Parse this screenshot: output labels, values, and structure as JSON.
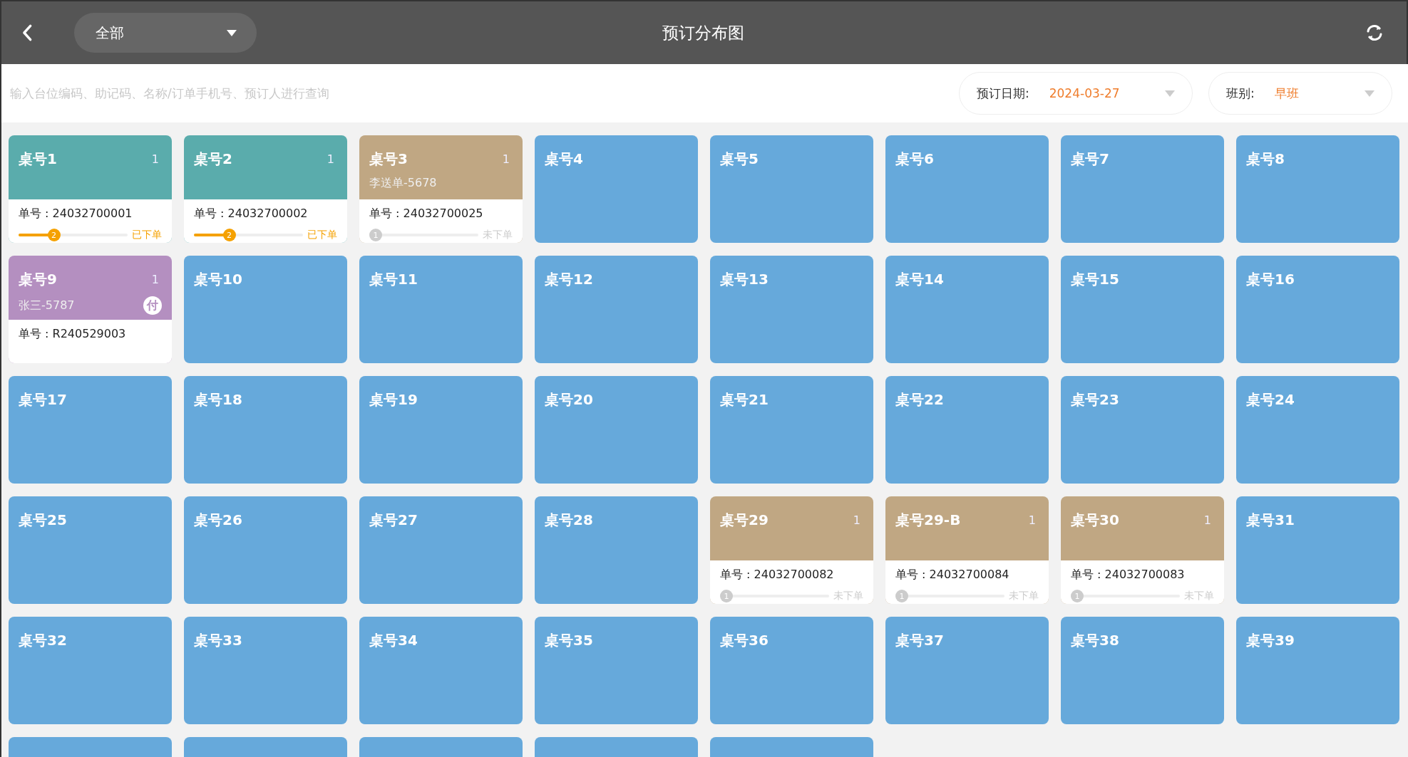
{
  "top_bar": {
    "title": "预订分布图",
    "area_filter": {
      "value": "全部"
    }
  },
  "search": {
    "placeholder": "输入台位编码、助记码、名称/订单手机号、预订人进行查询"
  },
  "filters": [
    {
      "label": "预订日期:",
      "value": "2024-03-27"
    },
    {
      "label": "班别:",
      "value": "早班"
    }
  ],
  "tables": [
    {
      "name": "桌号1",
      "color": "#5aacac",
      "count": "1",
      "order": {
        "number": "单号 : 24032700001",
        "step": "2",
        "level": 0.3,
        "status": "已下单",
        "placed": true
      }
    },
    {
      "name": "桌号2",
      "color": "#5aacac",
      "count": "1",
      "order": {
        "number": "单号 : 24032700002",
        "step": "2",
        "level": 0.3,
        "status": "已下单",
        "placed": true
      }
    },
    {
      "name": "桌号3",
      "color": "#c0a783",
      "count": "1",
      "guest": "李送单-5678",
      "order": {
        "number": "单号 : 24032700025",
        "step": "1",
        "level": 0,
        "status": "未下单",
        "placed": false
      }
    },
    {
      "name": "桌号4",
      "color": "#66a9db"
    },
    {
      "name": "桌号5",
      "color": "#66a9db"
    },
    {
      "name": "桌号6",
      "color": "#66a9db"
    },
    {
      "name": "桌号7",
      "color": "#66a9db"
    },
    {
      "name": "桌号8",
      "color": "#66a9db"
    },
    {
      "name": "桌号9",
      "color": "#b48fc0",
      "count": "1",
      "guest": "张三-5787",
      "badge": "付",
      "order": {
        "number": "单号 : R240529003"
      }
    },
    {
      "name": "桌号10",
      "color": "#66a9db"
    },
    {
      "name": "桌号11",
      "color": "#66a9db"
    },
    {
      "name": "桌号12",
      "color": "#66a9db"
    },
    {
      "name": "桌号13",
      "color": "#66a9db"
    },
    {
      "name": "桌号14",
      "color": "#66a9db"
    },
    {
      "name": "桌号15",
      "color": "#66a9db"
    },
    {
      "name": "桌号16",
      "color": "#66a9db"
    },
    {
      "name": "桌号17",
      "color": "#66a9db"
    },
    {
      "name": "桌号18",
      "color": "#66a9db"
    },
    {
      "name": "桌号19",
      "color": "#66a9db"
    },
    {
      "name": "桌号20",
      "color": "#66a9db"
    },
    {
      "name": "桌号21",
      "color": "#66a9db"
    },
    {
      "name": "桌号22",
      "color": "#66a9db"
    },
    {
      "name": "桌号23",
      "color": "#66a9db"
    },
    {
      "name": "桌号24",
      "color": "#66a9db"
    },
    {
      "name": "桌号25",
      "color": "#66a9db"
    },
    {
      "name": "桌号26",
      "color": "#66a9db"
    },
    {
      "name": "桌号27",
      "color": "#66a9db"
    },
    {
      "name": "桌号28",
      "color": "#66a9db"
    },
    {
      "name": "桌号29",
      "color": "#c0a783",
      "count": "1",
      "order": {
        "number": "单号 : 24032700082",
        "step": "1",
        "level": 0,
        "status": "未下单",
        "placed": false
      }
    },
    {
      "name": "桌号29-B",
      "color": "#c0a783",
      "count": "1",
      "order": {
        "number": "单号 : 24032700084",
        "step": "1",
        "level": 0,
        "status": "未下单",
        "placed": false
      }
    },
    {
      "name": "桌号30",
      "color": "#c0a783",
      "count": "1",
      "order": {
        "number": "单号 : 24032700083",
        "step": "1",
        "level": 0,
        "status": "未下单",
        "placed": false
      }
    },
    {
      "name": "桌号31",
      "color": "#66a9db"
    },
    {
      "name": "桌号32",
      "color": "#66a9db"
    },
    {
      "name": "桌号33",
      "color": "#66a9db"
    },
    {
      "name": "桌号34",
      "color": "#66a9db"
    },
    {
      "name": "桌号35",
      "color": "#66a9db"
    },
    {
      "name": "桌号36",
      "color": "#66a9db"
    },
    {
      "name": "桌号37",
      "color": "#66a9db"
    },
    {
      "name": "桌号38",
      "color": "#66a9db"
    },
    {
      "name": "桌号39",
      "color": "#66a9db"
    },
    {
      "color": "#66a9db"
    },
    {
      "color": "#66a9db"
    },
    {
      "color": "#66a9db"
    },
    {
      "color": "#66a9db"
    },
    {
      "color": "#66a9db"
    }
  ]
}
